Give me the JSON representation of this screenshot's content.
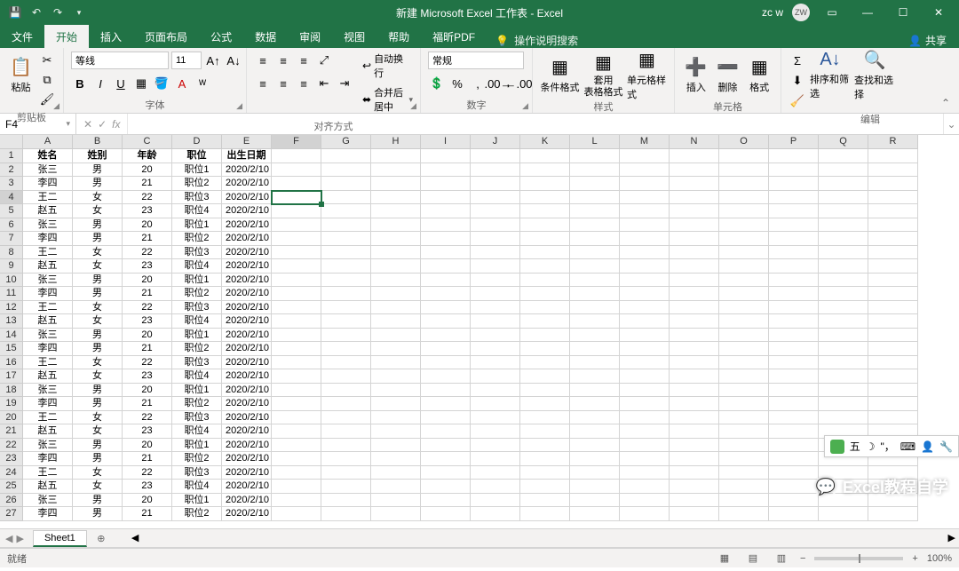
{
  "title": "新建 Microsoft Excel 工作表 - Excel",
  "user": {
    "name": "zc w",
    "initials": "ZW"
  },
  "tabs": {
    "file": "文件",
    "items": [
      "开始",
      "插入",
      "页面布局",
      "公式",
      "数据",
      "审阅",
      "视图",
      "帮助",
      "福昕PDF"
    ],
    "active": 0,
    "tellme": "操作说明搜索",
    "share": "共享"
  },
  "ribbon": {
    "clipboard": {
      "paste": "粘贴",
      "label": "剪贴板"
    },
    "font": {
      "name": "等线",
      "size": "11",
      "label": "字体"
    },
    "alignment": {
      "wrap": "自动换行",
      "merge": "合并后居中",
      "label": "对齐方式"
    },
    "number": {
      "format": "常规",
      "label": "数字"
    },
    "styles": {
      "cond": "条件格式",
      "table": "套用\n表格格式",
      "cell": "单元格样式",
      "label": "样式"
    },
    "cells": {
      "insert": "插入",
      "delete": "删除",
      "format": "格式",
      "label": "单元格"
    },
    "editing": {
      "sort": "排序和筛选",
      "find": "查找和选择",
      "label": "编辑"
    }
  },
  "namebox": "F4",
  "columns": [
    "A",
    "B",
    "C",
    "D",
    "E",
    "F",
    "G",
    "H",
    "I",
    "J",
    "K",
    "L",
    "M",
    "N",
    "O",
    "P",
    "Q",
    "R"
  ],
  "headers": [
    "姓名",
    "姓别",
    "年龄",
    "职位",
    "出生日期"
  ],
  "rows": [
    [
      "张三",
      "男",
      "20",
      "职位1",
      "2020/2/10"
    ],
    [
      "李四",
      "男",
      "21",
      "职位2",
      "2020/2/10"
    ],
    [
      "王二",
      "女",
      "22",
      "职位3",
      "2020/2/10"
    ],
    [
      "赵五",
      "女",
      "23",
      "职位4",
      "2020/2/10"
    ],
    [
      "张三",
      "男",
      "20",
      "职位1",
      "2020/2/10"
    ],
    [
      "李四",
      "男",
      "21",
      "职位2",
      "2020/2/10"
    ],
    [
      "王二",
      "女",
      "22",
      "职位3",
      "2020/2/10"
    ],
    [
      "赵五",
      "女",
      "23",
      "职位4",
      "2020/2/10"
    ],
    [
      "张三",
      "男",
      "20",
      "职位1",
      "2020/2/10"
    ],
    [
      "李四",
      "男",
      "21",
      "职位2",
      "2020/2/10"
    ],
    [
      "王二",
      "女",
      "22",
      "职位3",
      "2020/2/10"
    ],
    [
      "赵五",
      "女",
      "23",
      "职位4",
      "2020/2/10"
    ],
    [
      "张三",
      "男",
      "20",
      "职位1",
      "2020/2/10"
    ],
    [
      "李四",
      "男",
      "21",
      "职位2",
      "2020/2/10"
    ],
    [
      "王二",
      "女",
      "22",
      "职位3",
      "2020/2/10"
    ],
    [
      "赵五",
      "女",
      "23",
      "职位4",
      "2020/2/10"
    ],
    [
      "张三",
      "男",
      "20",
      "职位1",
      "2020/2/10"
    ],
    [
      "李四",
      "男",
      "21",
      "职位2",
      "2020/2/10"
    ],
    [
      "王二",
      "女",
      "22",
      "职位3",
      "2020/2/10"
    ],
    [
      "赵五",
      "女",
      "23",
      "职位4",
      "2020/2/10"
    ],
    [
      "张三",
      "男",
      "20",
      "职位1",
      "2020/2/10"
    ],
    [
      "李四",
      "男",
      "21",
      "职位2",
      "2020/2/10"
    ],
    [
      "王二",
      "女",
      "22",
      "职位3",
      "2020/2/10"
    ],
    [
      "赵五",
      "女",
      "23",
      "职位4",
      "2020/2/10"
    ],
    [
      "张三",
      "男",
      "20",
      "职位1",
      "2020/2/10"
    ],
    [
      "李四",
      "男",
      "21",
      "职位2",
      "2020/2/10"
    ]
  ],
  "active_cell": {
    "col": 5,
    "row": 4
  },
  "sheet": {
    "name": "Sheet1"
  },
  "sidetool": {
    "label": "五"
  },
  "status": {
    "ready": "就绪",
    "zoom": "100%"
  },
  "watermark": "Excel教程自学"
}
